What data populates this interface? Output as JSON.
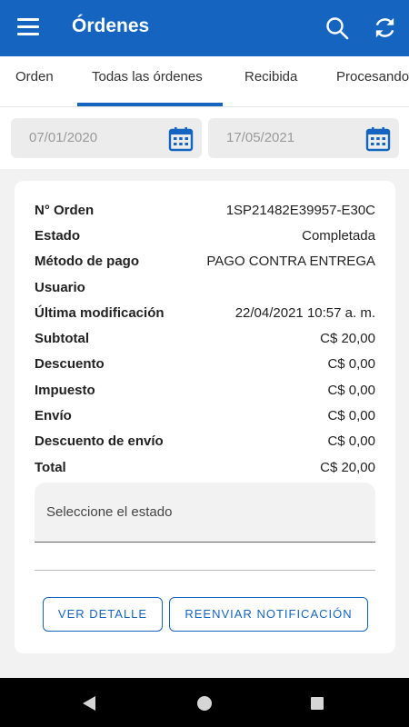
{
  "header": {
    "title": "Órdenes"
  },
  "tabs": [
    {
      "label": "Orden"
    },
    {
      "label": "Todas las órdenes",
      "active": true
    },
    {
      "label": "Recibida"
    },
    {
      "label": "Procesando"
    }
  ],
  "filters": {
    "date_from": "07/01/2020",
    "date_to": "17/05/2021"
  },
  "order": {
    "rows": [
      {
        "label": "N° Orden",
        "value": "1SP21482E39957-E30C"
      },
      {
        "label": "Estado",
        "value": "Completada"
      },
      {
        "label": "Método de pago",
        "value": "PAGO CONTRA ENTREGA"
      },
      {
        "label": "Usuario",
        "value": ""
      },
      {
        "label": "Última modificación",
        "value": "22/04/2021 10:57 a. m."
      },
      {
        "label": "Subtotal",
        "value": "C$ 20,00"
      },
      {
        "label": "Descuento",
        "value": "C$ 0,00"
      },
      {
        "label": "Impuesto",
        "value": "C$ 0,00"
      },
      {
        "label": "Envío",
        "value": "C$ 0,00"
      },
      {
        "label": "Descuento de envío",
        "value": "C$ 0,00"
      },
      {
        "label": "Total",
        "value": "C$ 20,00"
      }
    ],
    "status_placeholder": "Seleccione el estado",
    "detail_button": "VER DETALLE",
    "resend_button": "REENVIAR NOTIFICACIÓN"
  },
  "colors": {
    "primary": "#1565c0",
    "background": "#f2f2f2"
  },
  "icons": {
    "menu": "menu-icon",
    "search": "search-icon",
    "refresh": "refresh-icon",
    "calendar": "calendar-icon",
    "back": "back-icon",
    "home": "home-icon",
    "recents": "recents-icon"
  }
}
